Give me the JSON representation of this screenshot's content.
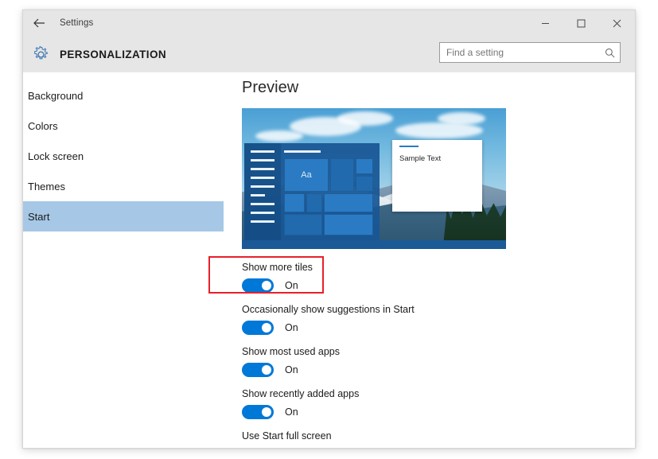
{
  "window": {
    "app_title": "Settings",
    "page_title": "PERSONALIZATION",
    "back_icon": "back-arrow-icon",
    "gear_icon": "gear-icon",
    "controls": {
      "minimize": "minimize-icon",
      "maximize": "maximize-icon",
      "close": "close-icon"
    }
  },
  "search": {
    "placeholder": "Find a setting",
    "value": "",
    "icon": "search-icon"
  },
  "sidebar": {
    "items": [
      {
        "label": "Background",
        "selected": false
      },
      {
        "label": "Colors",
        "selected": false
      },
      {
        "label": "Lock screen",
        "selected": false
      },
      {
        "label": "Themes",
        "selected": false
      },
      {
        "label": "Start",
        "selected": true
      }
    ],
    "selected_color": "#a6c8e6"
  },
  "main": {
    "section_title": "Preview",
    "preview": {
      "tile_label": "Aa",
      "sample_window_text": "Sample Text"
    },
    "settings": [
      {
        "label": "Show more tiles",
        "state": "On",
        "highlighted": true
      },
      {
        "label": "Occasionally show suggestions in Start",
        "state": "On",
        "highlighted": false
      },
      {
        "label": "Show most used apps",
        "state": "On",
        "highlighted": false
      },
      {
        "label": "Show recently added apps",
        "state": "On",
        "highlighted": false
      }
    ],
    "clipped_setting_label": "Use Start full screen"
  },
  "colors": {
    "accent": "#0078d7",
    "highlight_annotation": "#e8202a",
    "header_band": "#e6e6e6",
    "selection": "#a6c8e6"
  }
}
